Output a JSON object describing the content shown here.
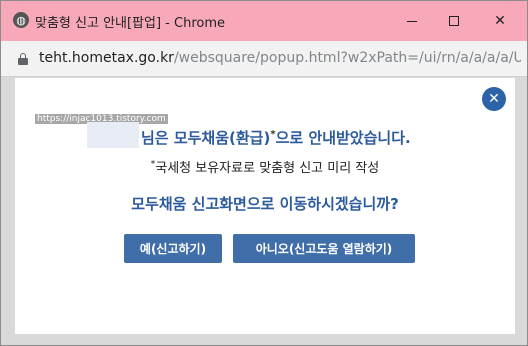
{
  "window": {
    "title": "맞춤형 신고 안내[팝업] - Chrome",
    "icon": "globe-icon",
    "minimize_icon": "minimize-icon",
    "maximize_icon": "maximize-icon",
    "close_glyph": "✕"
  },
  "address_bar": {
    "url_host": "teht.hometax.go.kr",
    "url_rest": "/websquare/popup.html?w2xPath=/ui/rn/a/a/a/a/UT..."
  },
  "popup": {
    "watermark": "https://injac1013.tistory.com",
    "close_glyph": "✕",
    "message_line1": "님은 모두채움(환급)",
    "message_line1_sup": "*",
    "message_line1_tail": "으로 안내받았습니다.",
    "note_sup": "*",
    "note": "국세청 보유자료로 맞춤형 신고 미리 작성",
    "question": "모두채움 신고화면으로 이동하시겠습니까?",
    "yes_button": "예(신고하기)",
    "no_button": "아니오(신고도움 열람하기)"
  },
  "colors": {
    "titlebar": "#f7a9ba",
    "accent": "#2c5b9c",
    "button": "#3f6ea8"
  }
}
